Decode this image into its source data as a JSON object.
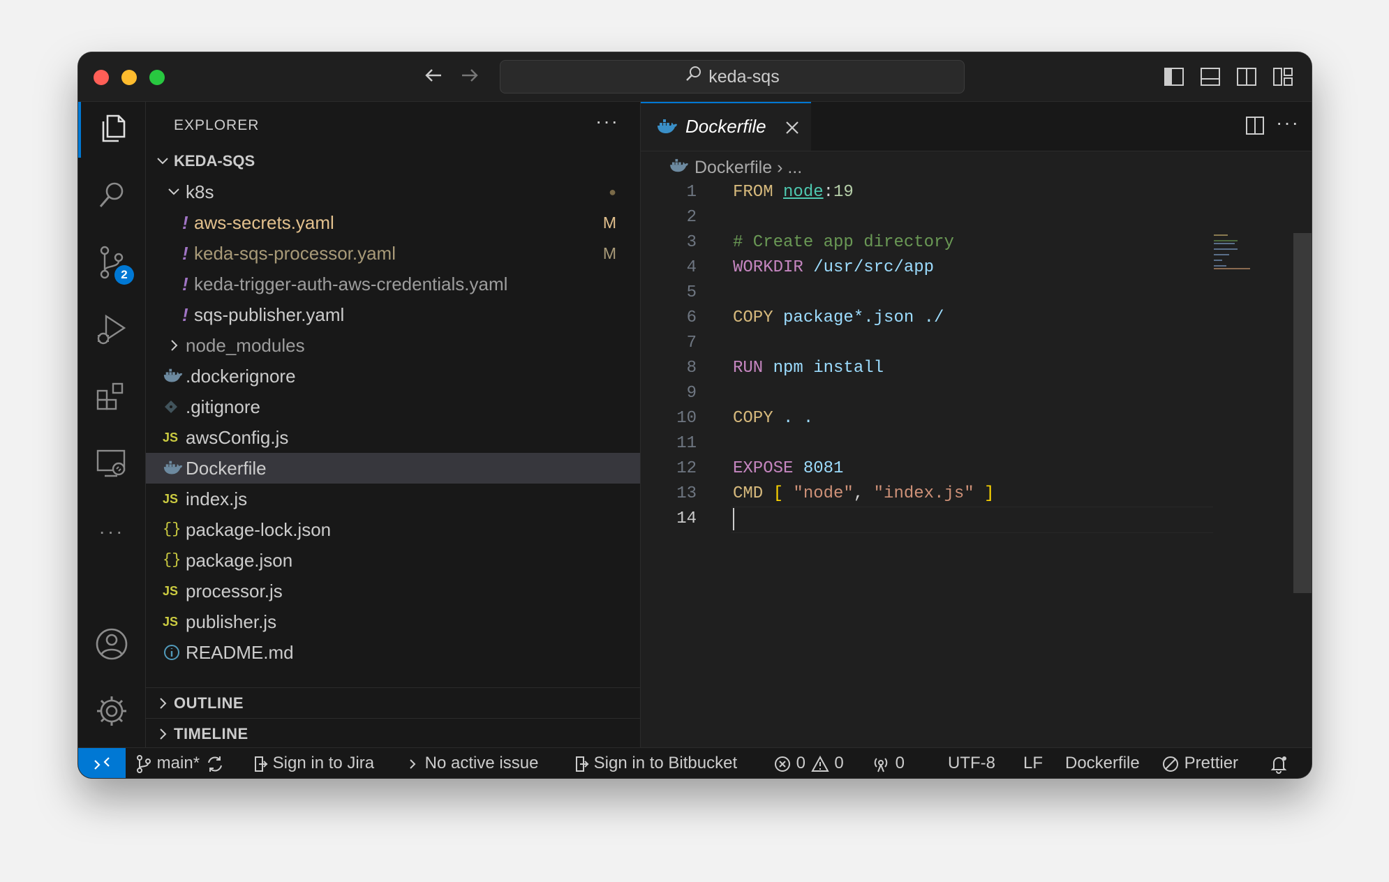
{
  "window": {
    "search_text": "keda-sqs"
  },
  "activity": {
    "scm_badge": "2"
  },
  "sidebar": {
    "header": "EXPLORER",
    "more": "···",
    "root": "KEDA-SQS",
    "items": [
      {
        "label": "k8s",
        "type": "folder-open",
        "deco": "●"
      },
      {
        "label": "aws-secrets.yaml",
        "type": "yaml",
        "deco": "M"
      },
      {
        "label": "keda-sqs-processor.yaml",
        "type": "yaml",
        "deco": "M"
      },
      {
        "label": "keda-trigger-auth-aws-credentials.yaml",
        "type": "yaml",
        "deco": ""
      },
      {
        "label": "sqs-publisher.yaml",
        "type": "yaml",
        "deco": ""
      },
      {
        "label": "node_modules",
        "type": "folder-closed",
        "deco": ""
      },
      {
        "label": ".dockerignore",
        "type": "docker",
        "deco": ""
      },
      {
        "label": ".gitignore",
        "type": "git",
        "deco": ""
      },
      {
        "label": "awsConfig.js",
        "type": "js",
        "deco": ""
      },
      {
        "label": "Dockerfile",
        "type": "docker",
        "deco": ""
      },
      {
        "label": "index.js",
        "type": "js",
        "deco": ""
      },
      {
        "label": "package-lock.json",
        "type": "json",
        "deco": ""
      },
      {
        "label": "package.json",
        "type": "json",
        "deco": ""
      },
      {
        "label": "processor.js",
        "type": "js",
        "deco": ""
      },
      {
        "label": "publisher.js",
        "type": "js",
        "deco": ""
      },
      {
        "label": "README.md",
        "type": "info",
        "deco": ""
      }
    ],
    "icon_text": {
      "js": "JS",
      "json": "{}",
      "yaml": "!"
    },
    "sections": [
      "OUTLINE",
      "TIMELINE"
    ]
  },
  "editor": {
    "tab_label": "Dockerfile",
    "breadcrumb_file": "Dockerfile",
    "breadcrumb_rest": "...",
    "lines": [
      {
        "n": "1",
        "tokens": [
          [
            "kw",
            "FROM "
          ],
          [
            "ty",
            "node"
          ],
          [
            "plain",
            ":"
          ],
          [
            "num",
            "19"
          ]
        ]
      },
      {
        "n": "2",
        "tokens": []
      },
      {
        "n": "3",
        "tokens": [
          [
            "cmt",
            "# Create app directory"
          ]
        ]
      },
      {
        "n": "4",
        "tokens": [
          [
            "kw2",
            "WORKDIR "
          ],
          [
            "id",
            "/usr/src/app"
          ]
        ]
      },
      {
        "n": "5",
        "tokens": []
      },
      {
        "n": "6",
        "tokens": [
          [
            "kw",
            "COPY "
          ],
          [
            "id",
            "package*.json ./"
          ]
        ]
      },
      {
        "n": "7",
        "tokens": []
      },
      {
        "n": "8",
        "tokens": [
          [
            "kw2",
            "RUN "
          ],
          [
            "id",
            "npm install"
          ]
        ]
      },
      {
        "n": "9",
        "tokens": []
      },
      {
        "n": "10",
        "tokens": [
          [
            "kw",
            "COPY "
          ],
          [
            "id",
            ". ."
          ]
        ]
      },
      {
        "n": "11",
        "tokens": []
      },
      {
        "n": "12",
        "tokens": [
          [
            "kw2",
            "EXPOSE "
          ],
          [
            "id",
            "8081"
          ]
        ]
      },
      {
        "n": "13",
        "tokens": [
          [
            "kw",
            "CMD "
          ],
          [
            "br",
            "[ "
          ],
          [
            "str",
            "\"node\""
          ],
          [
            "plain",
            ", "
          ],
          [
            "str",
            "\"index.js\""
          ],
          [
            "br",
            " ]"
          ]
        ]
      },
      {
        "n": "14",
        "tokens": []
      }
    ]
  },
  "statusbar": {
    "branch": "main*",
    "jira": "Sign in to Jira",
    "issue": "No active issue",
    "bitbucket": "Sign in to Bitbucket",
    "errors": "0",
    "warnings": "0",
    "ports": "0",
    "encoding": "UTF-8",
    "eol": "LF",
    "language": "Dockerfile",
    "formatter": "Prettier"
  },
  "colors": {
    "accent": "#0078d4",
    "modified": "#e2c08d",
    "js": "#cbcb41",
    "yaml": "#a074c4",
    "docker": "#6d8086"
  }
}
